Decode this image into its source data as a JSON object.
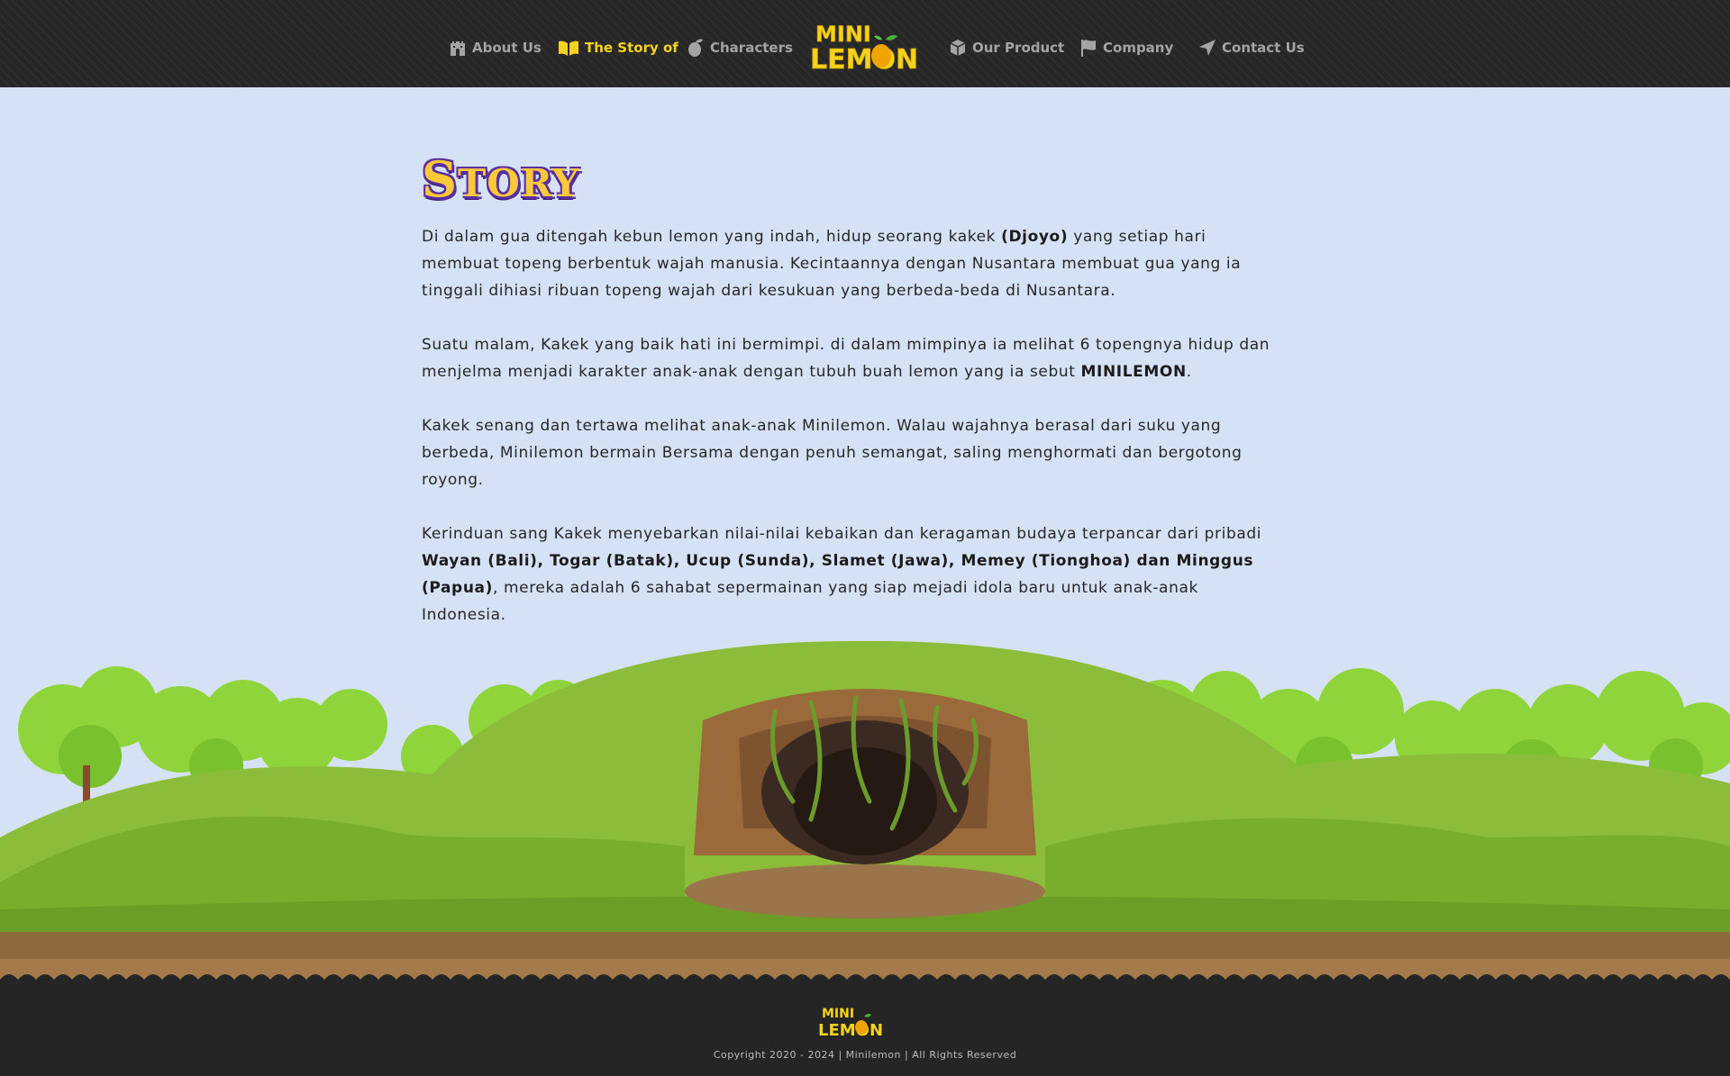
{
  "brand": {
    "logo_text_top": "MINI",
    "logo_text_bottom": "LEMON"
  },
  "nav": {
    "items": [
      {
        "label": "About Us",
        "icon": "castle-gate-icon"
      },
      {
        "label": "The Story of",
        "icon": "open-book-icon",
        "active": true
      },
      {
        "label": "Characters",
        "icon": "lemon-icon"
      },
      {
        "label": "Our Product",
        "icon": "box-icon"
      },
      {
        "label": "Company",
        "icon": "flag-icon"
      },
      {
        "label": "Contact Us",
        "icon": "paper-plane-icon"
      }
    ]
  },
  "story": {
    "title_first": "S",
    "title_rest": "TORY",
    "p1": {
      "before": "Di dalam gua ditengah kebun lemon yang indah, hidup seorang kakek ",
      "bold": "(Djoyo)",
      "after": " yang setiap hari membuat topeng berbentuk wajah manusia. Kecintaannya dengan Nusantara membuat gua yang ia tinggali dihiasi ribuan topeng wajah dari kesukuan yang berbeda-beda di Nusantara."
    },
    "p2": {
      "before": "Suatu malam, Kakek yang baik hati ini bermimpi. di dalam mimpinya ia melihat 6 topengnya hidup dan menjelma menjadi karakter anak-anak dengan tubuh buah lemon yang ia sebut ",
      "bold": "MINILEMON",
      "after": "."
    },
    "p3": "Kakek senang dan tertawa melihat anak-anak Minilemon. Walau wajahnya berasal dari suku yang berbeda, Minilemon bermain Bersama dengan penuh semangat, saling menghormati dan bergotong royong.",
    "p4": {
      "before": "Kerinduan sang Kakek menyebarkan nilai-nilai kebaikan dan keragaman budaya terpancar dari pribadi ",
      "bold": "Wayan (Bali), Togar (Batak), Ucup (Sunda), Slamet (Jawa), Memey (Tionghoa) dan Minggus (Papua)",
      "after": ", mereka adalah 6 sahabat sepermainan yang siap mejadi idola baru untuk anak-anak Indonesia."
    }
  },
  "footer": {
    "copyright": "Copyright 2020 - 2024 | Minilemon | All Rights Reserved"
  },
  "colors": {
    "nav_bg": "#272727",
    "accent": "#f5d21b",
    "page_bg": "#d5e2f5",
    "footer_bg": "#252525"
  }
}
